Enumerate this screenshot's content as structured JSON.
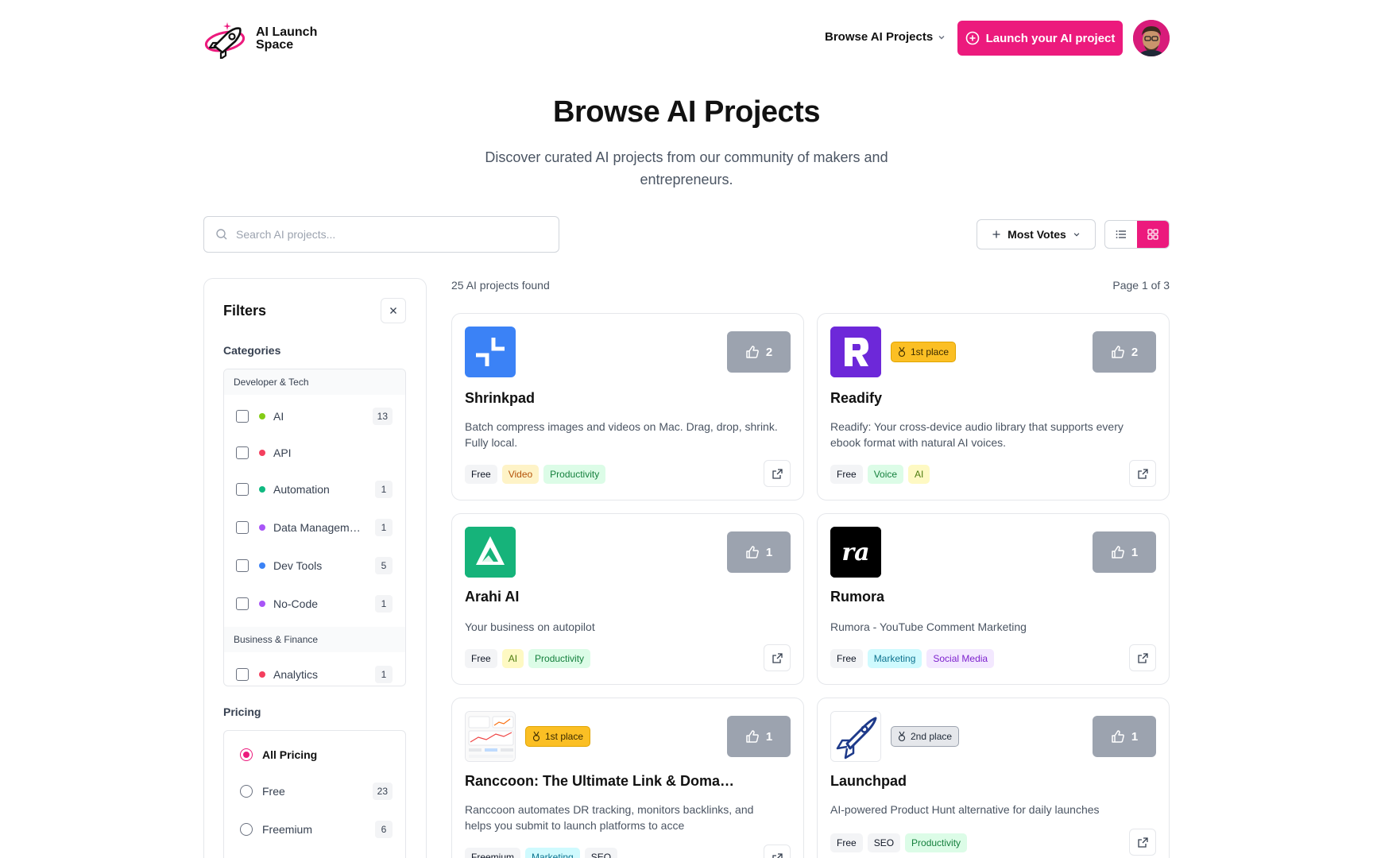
{
  "header": {
    "logo_line1": "AI Launch",
    "logo_line2": "Space",
    "nav_browse": "Browse AI Projects",
    "launch_button": "Launch your AI project"
  },
  "hero": {
    "title": "Browse AI Projects",
    "subtitle": "Discover curated AI projects from our community of makers and entrepreneurs."
  },
  "search": {
    "placeholder": "Search AI projects..."
  },
  "sort": {
    "label": "Most Votes"
  },
  "filters": {
    "title": "Filters",
    "categories_label": "Categories",
    "groups": [
      {
        "name": "Developer & Tech"
      },
      {
        "name": "Business & Finance"
      }
    ],
    "categories": [
      {
        "label": "AI",
        "count": "13",
        "dot": "#84cc16"
      },
      {
        "label": "API",
        "count": "",
        "dot": "#f43f5e"
      },
      {
        "label": "Automation",
        "count": "1",
        "dot": "#10b981"
      },
      {
        "label": "Data Management",
        "count": "1",
        "dot": "#a855f7"
      },
      {
        "label": "Dev Tools",
        "count": "5",
        "dot": "#3b82f6"
      },
      {
        "label": "No-Code",
        "count": "1",
        "dot": "#a855f7"
      },
      {
        "label": "Analytics",
        "count": "1",
        "dot": "#f43f5e"
      }
    ],
    "pricing_label": "Pricing",
    "pricing": [
      {
        "label": "All Pricing",
        "count": "",
        "checked": true
      },
      {
        "label": "Free",
        "count": "23",
        "checked": false
      },
      {
        "label": "Freemium",
        "count": "6",
        "checked": false
      }
    ]
  },
  "results": {
    "count_text": "25 AI projects found",
    "page_text": "Page 1 of 3"
  },
  "projects": [
    {
      "name": "Shrinkpad",
      "description": "Batch compress images and videos on Mac. Drag, drop, shrink. Fully local.",
      "votes": "2",
      "badge": "",
      "tags": [
        {
          "label": "Free",
          "bg": "#f3f4f6",
          "fg": "#111827"
        },
        {
          "label": "Video",
          "bg": "#fef3c7",
          "fg": "#b45309"
        },
        {
          "label": "Productivity",
          "bg": "#dcfce7",
          "fg": "#15803d"
        }
      ]
    },
    {
      "name": "Readify",
      "description": "Readify: Your cross-device audio library that supports every ebook format with natural AI voices.",
      "votes": "2",
      "badge": "1st place",
      "tags": [
        {
          "label": "Free",
          "bg": "#f3f4f6",
          "fg": "#111827"
        },
        {
          "label": "Voice",
          "bg": "#dcfce7",
          "fg": "#15803d"
        },
        {
          "label": "AI",
          "bg": "#fef9c3",
          "fg": "#4d7c0f"
        }
      ]
    },
    {
      "name": "Arahi AI",
      "description": "Your business on autopilot",
      "votes": "1",
      "badge": "",
      "tags": [
        {
          "label": "Free",
          "bg": "#f3f4f6",
          "fg": "#111827"
        },
        {
          "label": "AI",
          "bg": "#fef9c3",
          "fg": "#4d7c0f"
        },
        {
          "label": "Productivity",
          "bg": "#dcfce7",
          "fg": "#15803d"
        }
      ]
    },
    {
      "name": "Rumora",
      "description": "Rumora - YouTube Comment Marketing",
      "votes": "1",
      "badge": "",
      "tags": [
        {
          "label": "Free",
          "bg": "#f3f4f6",
          "fg": "#111827"
        },
        {
          "label": "Marketing",
          "bg": "#cffafe",
          "fg": "#0e7490"
        },
        {
          "label": "Social Media",
          "bg": "#f3e8ff",
          "fg": "#7e22ce"
        }
      ]
    },
    {
      "name": "Ranccoon: The Ultimate Link & Domain Rating Tracker",
      "description": "Ranccoon automates DR tracking, monitors backlinks, and helps you submit to launch platforms to acce",
      "votes": "1",
      "badge": "1st place",
      "tags": [
        {
          "label": "Freemium",
          "bg": "#f3f4f6",
          "fg": "#111827"
        },
        {
          "label": "Marketing",
          "bg": "#cffafe",
          "fg": "#0e7490"
        },
        {
          "label": "SEO",
          "bg": "#f3f4f6",
          "fg": "#111827"
        }
      ]
    },
    {
      "name": "Launchpad",
      "description": "AI-powered Product Hunt alternative for daily launches",
      "votes": "1",
      "badge": "2nd place",
      "tags": [
        {
          "label": "Free",
          "bg": "#f3f4f6",
          "fg": "#111827"
        },
        {
          "label": "SEO",
          "bg": "#f3f4f6",
          "fg": "#111827"
        },
        {
          "label": "Productivity",
          "bg": "#dcfce7",
          "fg": "#15803d"
        }
      ]
    }
  ]
}
